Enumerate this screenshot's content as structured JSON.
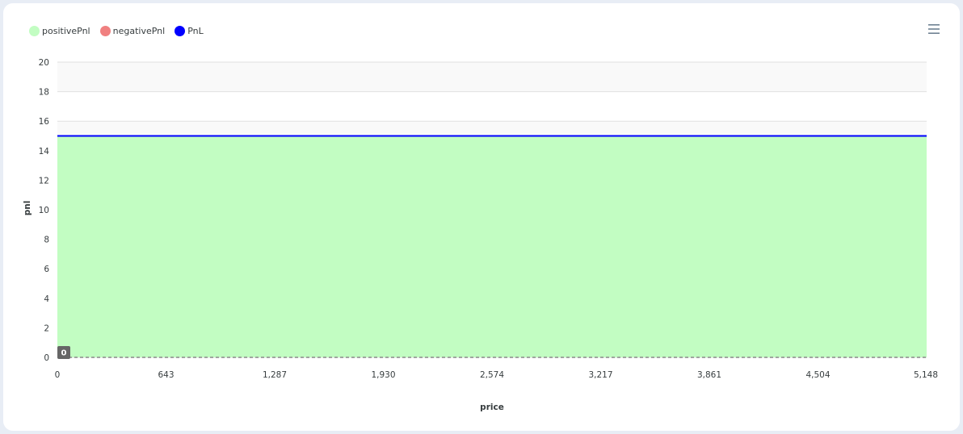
{
  "legend": [
    {
      "name": "positivePnl",
      "color": "#c2fdc2"
    },
    {
      "name": "negativePnl",
      "color": "#f08080"
    },
    {
      "name": "PnL",
      "color": "#0000ff"
    }
  ],
  "menu": {
    "icon": "hamburger-menu-icon"
  },
  "zero_annotation": "0",
  "chart_data": {
    "type": "area",
    "xlabel": "price",
    "ylabel": "pnl",
    "xlim": [
      0,
      5148
    ],
    "ylim": [
      0,
      20
    ],
    "x_ticks": [
      "0",
      "643",
      "1,287",
      "1,930",
      "2,574",
      "3,217",
      "3,861",
      "4,504",
      "5,148"
    ],
    "y_ticks": [
      "0",
      "2",
      "4",
      "6",
      "8",
      "10",
      "12",
      "14",
      "16",
      "18",
      "20"
    ],
    "grid": "horizontal",
    "legend_position": "top-left",
    "series": [
      {
        "name": "positivePnl",
        "color": "#c2fdc2",
        "x": [
          0,
          5148
        ],
        "values": [
          15,
          15
        ]
      },
      {
        "name": "negativePnl",
        "color": "#f08080",
        "x": [
          0,
          5148
        ],
        "values": [
          0,
          0
        ]
      },
      {
        "name": "PnL",
        "color": "#0000ff",
        "x": [
          0,
          5148
        ],
        "values": [
          15,
          15
        ]
      }
    ],
    "annotations": [
      {
        "y": 0,
        "label": "0",
        "style": "dashed"
      }
    ]
  }
}
